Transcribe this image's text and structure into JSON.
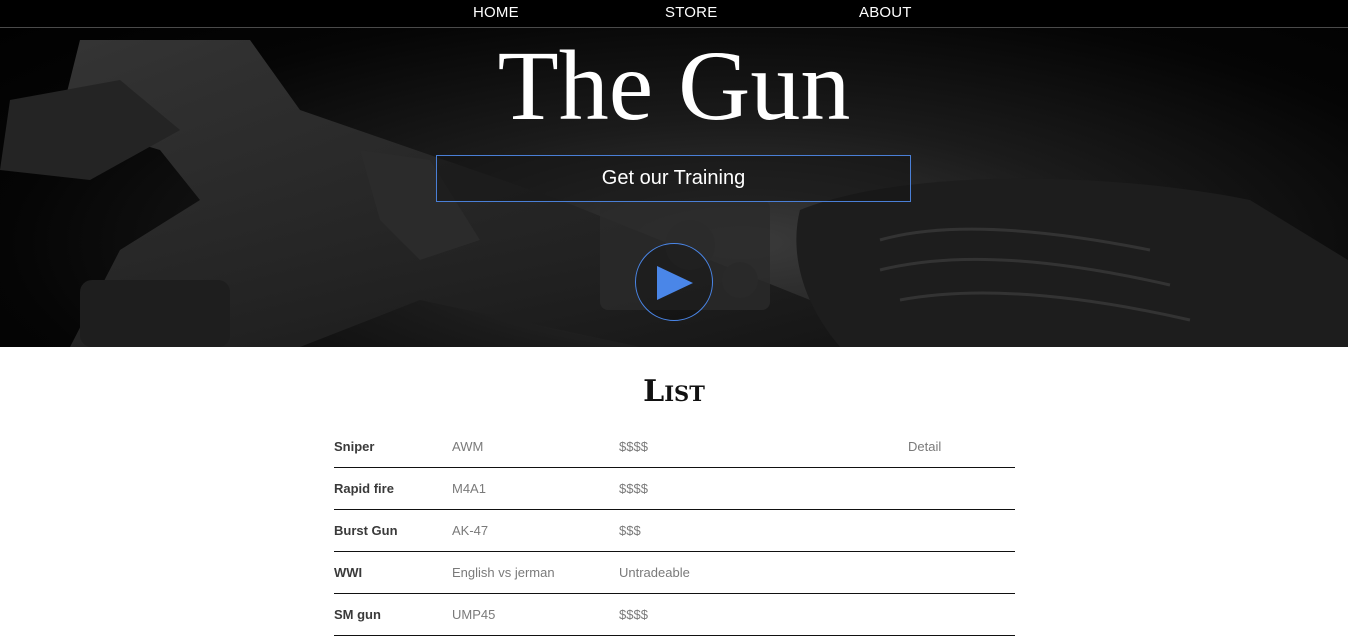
{
  "nav": {
    "items": [
      {
        "label": "HOME"
      },
      {
        "label": "STORE"
      },
      {
        "label": "ABOUT"
      }
    ]
  },
  "hero": {
    "title": "The Gun",
    "cta_label": "Get our Training"
  },
  "list": {
    "title": "List",
    "rows": [
      {
        "type": "Sniper",
        "model": "AWM",
        "price": "$$$$",
        "detail": "Detail"
      },
      {
        "type": "Rapid fire",
        "model": "M4A1",
        "price": "$$$$",
        "detail": ""
      },
      {
        "type": "Burst Gun",
        "model": "AK-47",
        "price": "$$$",
        "detail": ""
      },
      {
        "type": "WWI",
        "model": "English vs jerman",
        "price": "Untradeable",
        "detail": ""
      },
      {
        "type": "SM gun",
        "model": "UMP45",
        "price": "$$$$",
        "detail": ""
      }
    ]
  },
  "colors": {
    "accent": "#4a86e8",
    "nav_bg": "#000000",
    "text_dark": "#3a3a3a",
    "text_muted": "#7a7a7a"
  },
  "icons": {
    "play": "play-icon"
  }
}
